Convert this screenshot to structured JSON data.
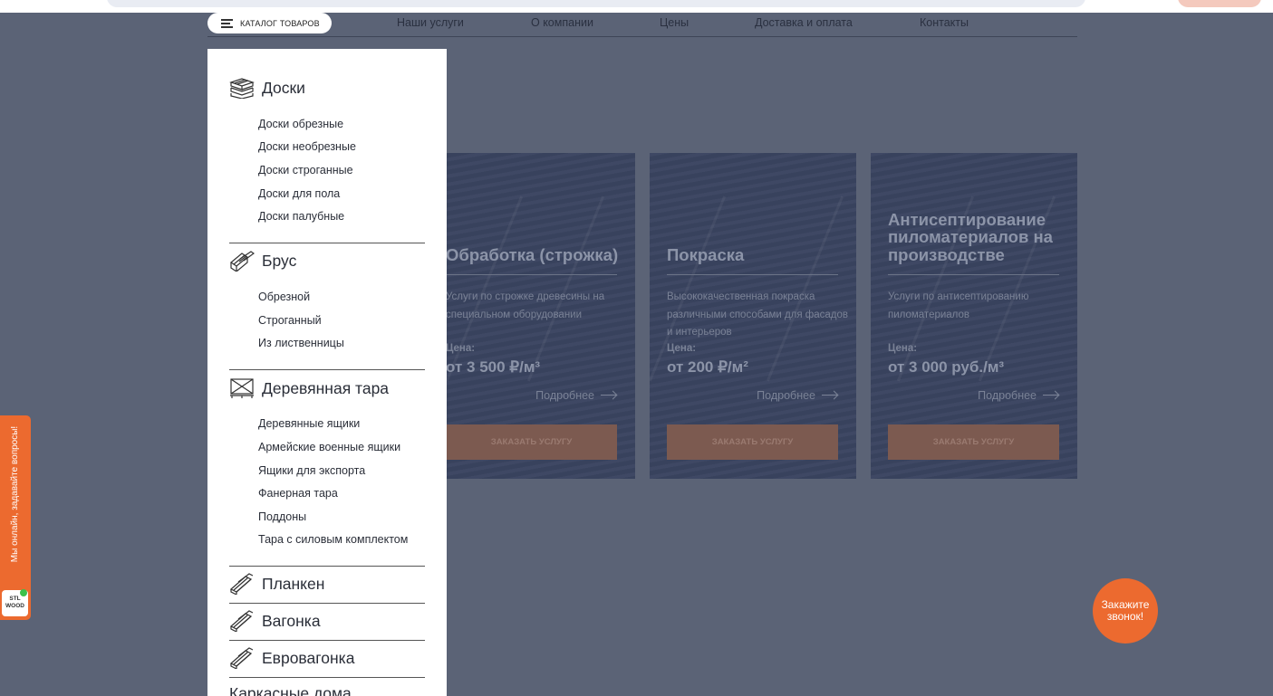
{
  "nav": {
    "catalog_label": "КАТАЛОГ ТОВАРОВ",
    "links": [
      "Наши услуги",
      "О компании",
      "Цены",
      "Доставка и оплата",
      "Контакты"
    ]
  },
  "cards": [
    {
      "title": "Обработка (строжка)",
      "desc": "Услуги по строжке древесины на специальном оборудовании",
      "price_label": "Цена:",
      "price": "от 3 500 ₽/м³",
      "more": "Подробнее",
      "order": "ЗАКАЗАТЬ УСЛУГУ"
    },
    {
      "title": "Покраска",
      "desc": "Высококачественная покраска различными способами для фасадов и интерьеров",
      "price_label": "Цена:",
      "price": "от 200 ₽/м²",
      "more": "Подробнее",
      "order": "ЗАКАЗАТЬ УСЛУГУ"
    },
    {
      "title": "Антисептирование пиломатериалов на производстве",
      "desc": "Услуги по антисептированию пиломатериалов",
      "price_label": "Цена:",
      "price": "от 3 000 руб./м³",
      "more": "Подробнее",
      "order": "ЗАКАЗАТЬ УСЛУГУ"
    }
  ],
  "menu": {
    "categories": [
      {
        "label": "Доски",
        "icon": "boards-icon",
        "items": [
          "Доски обрезные",
          "Доски необрезные",
          "Доски строганные",
          "Доски для пола",
          "Доски палубные"
        ]
      },
      {
        "label": "Брус",
        "icon": "beam-icon",
        "items": [
          "Обрезной",
          "Строганный",
          "Из лиственницы"
        ]
      },
      {
        "label": "Деревянная тара",
        "icon": "pallet-icon",
        "items": [
          "Деревянные ящики",
          "Армейские военные ящики",
          "Ящики для экспорта",
          "Фанерная тара",
          "Поддоны",
          "Тара с силовым комплектом"
        ]
      },
      {
        "label": "Планкен",
        "icon": "planks-icon",
        "items": []
      },
      {
        "label": "Вагонка",
        "icon": "planks-icon",
        "items": []
      },
      {
        "label": "Евровагонка",
        "icon": "planks-icon",
        "items": []
      },
      {
        "label": "Каркасные дома",
        "icon": "",
        "items": []
      }
    ]
  },
  "side_widget": {
    "text": "Мы онлайн, задавайте вопросы!",
    "logo": "STL WOOD"
  },
  "callback": {
    "label": "Закажите звонок!"
  },
  "colors": {
    "accent": "#ec6a2f",
    "overlay": "#5b6376",
    "menu_bg": "#ffffff"
  }
}
